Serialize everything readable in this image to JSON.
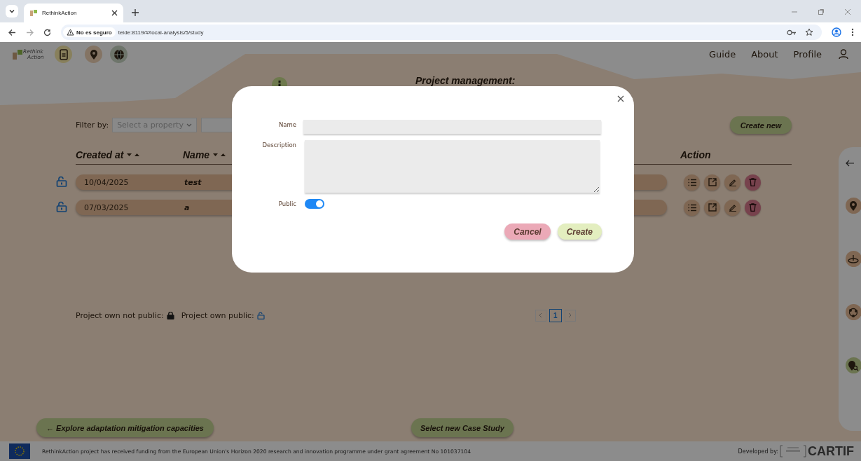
{
  "browser": {
    "tab_title": "RethinkAction",
    "security": "No es seguro",
    "url": "teide:8119/#/local-analysis/5/study"
  },
  "header": {
    "logo": [
      "Rethink",
      "Action"
    ],
    "nav": [
      "Guide",
      "About",
      "Profile"
    ]
  },
  "page": {
    "title": "Project management:",
    "filter": {
      "label": "Filter by:",
      "placeholder": "Select a property"
    },
    "create_button": "Create new",
    "columns": [
      {
        "label": "Created at",
        "sortable": true
      },
      {
        "label": "Name",
        "sortable": true
      },
      {
        "label": "Action",
        "sortable": false
      }
    ],
    "rows": [
      {
        "created_at": "10/04/2025",
        "name": "test",
        "public": true
      },
      {
        "created_at": "07/03/2025",
        "name": "a",
        "public": true
      }
    ],
    "legend": [
      {
        "label": "Project own not public:",
        "public": false
      },
      {
        "label": "Project own public:",
        "public": true
      }
    ],
    "pagination": [
      {
        "label": "1",
        "selected": true
      }
    ],
    "buttons": [
      {
        "label": "← Explore adaptation mitigation capacities"
      },
      {
        "label": "Select new Case Study"
      }
    ]
  },
  "dialog": {
    "fields": [
      {
        "kind": "text",
        "label": "Name"
      },
      {
        "kind": "textarea",
        "label": "Description"
      },
      {
        "kind": "toggle",
        "label": "Public",
        "on": true
      }
    ],
    "buttons": [
      {
        "kind": "cancel",
        "label": "Cancel"
      },
      {
        "kind": "confirm",
        "label": "Create"
      }
    ]
  },
  "footer": {
    "funding": "RethinkAction project has received funding from the European Union's Horizon 2020 research and innovation programme under grant agreement No 101037104",
    "developed_by": "Developed by:",
    "brand": "CARTIF"
  }
}
